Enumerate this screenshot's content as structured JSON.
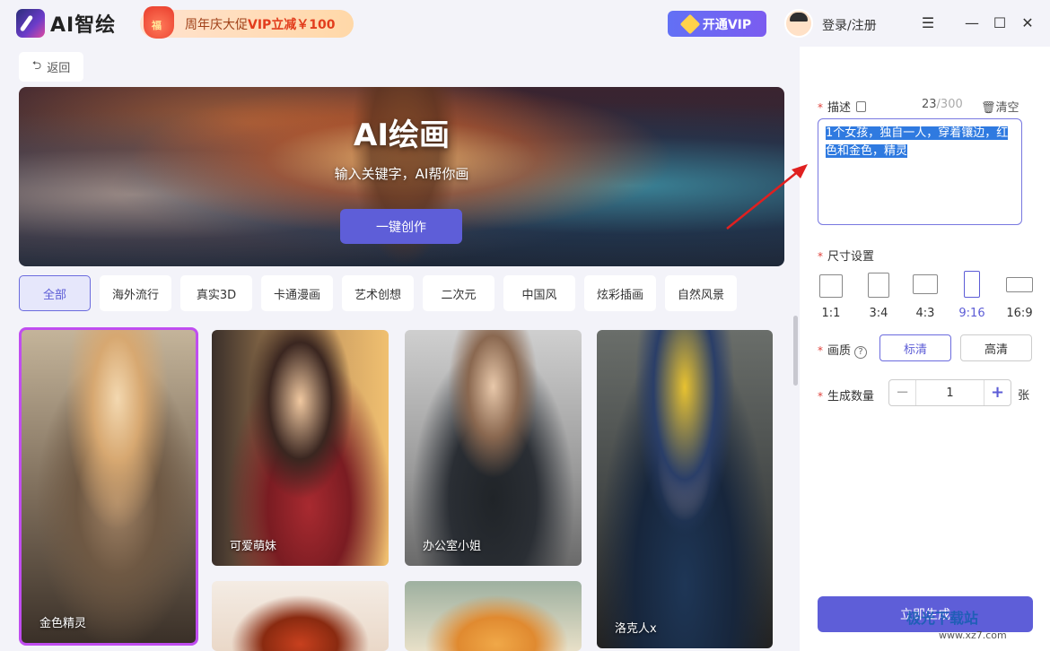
{
  "app": {
    "name": "AI智绘"
  },
  "promo": {
    "bag_text": "福",
    "prefix": "周年庆大促",
    "highlight": "VIP立减￥100"
  },
  "header": {
    "vip_label": "开通VIP",
    "login_label": "登录/注册"
  },
  "back": {
    "label": "返回"
  },
  "hero": {
    "title": "AI绘画",
    "subtitle": "输入关键字，AI帮你画",
    "button": "一键创作"
  },
  "tabs": [
    {
      "label": "全部",
      "active": true
    },
    {
      "label": "海外流行"
    },
    {
      "label": "真实3D"
    },
    {
      "label": "卡通漫画"
    },
    {
      "label": "艺术创想"
    },
    {
      "label": "二次元"
    },
    {
      "label": "中国风"
    },
    {
      "label": "炫彩插画"
    },
    {
      "label": "自然风景"
    }
  ],
  "gallery": [
    {
      "caption": "金色精灵",
      "selected": true
    },
    {
      "caption": "可爱萌妹"
    },
    {
      "caption": "办公室小姐"
    },
    {
      "caption": "洛克人x"
    },
    {
      "caption": ""
    },
    {
      "caption": ""
    }
  ],
  "panel": {
    "desc_label": "描述",
    "char_count": "23",
    "char_max": "/300",
    "clear_label": "清空",
    "desc_selected": "1个女孩，独自一人，穿着镶边，红色和金色，精灵",
    "size_label": "尺寸设置",
    "sizes": [
      {
        "label": "1:1"
      },
      {
        "label": "3:4"
      },
      {
        "label": "4:3"
      },
      {
        "label": "9:16",
        "active": true
      },
      {
        "label": "16:9"
      }
    ],
    "quality_label": "画质",
    "quality_options": [
      {
        "label": "标清",
        "active": true
      },
      {
        "label": "高清"
      }
    ],
    "count_label": "生成数量",
    "count_value": "1",
    "count_unit": "张",
    "generate_label": "立即生成"
  },
  "watermark": {
    "brand": "极光下载站",
    "url": "www.xz7.com"
  },
  "colors": {
    "accent": "#5e5ed8",
    "selection": "#2f7ae0",
    "required": "#e0403a",
    "card_highlight": "#c04df0"
  },
  "icons": [
    "logo-icon",
    "gift-bag-icon",
    "diamond-icon",
    "avatar-icon",
    "menu-icon",
    "minimize-icon",
    "maximize-icon",
    "close-icon",
    "back-arrow-icon",
    "copy-icon",
    "trash-icon",
    "help-icon",
    "minus-icon",
    "plus-icon",
    "arrow-annotation-icon"
  ]
}
